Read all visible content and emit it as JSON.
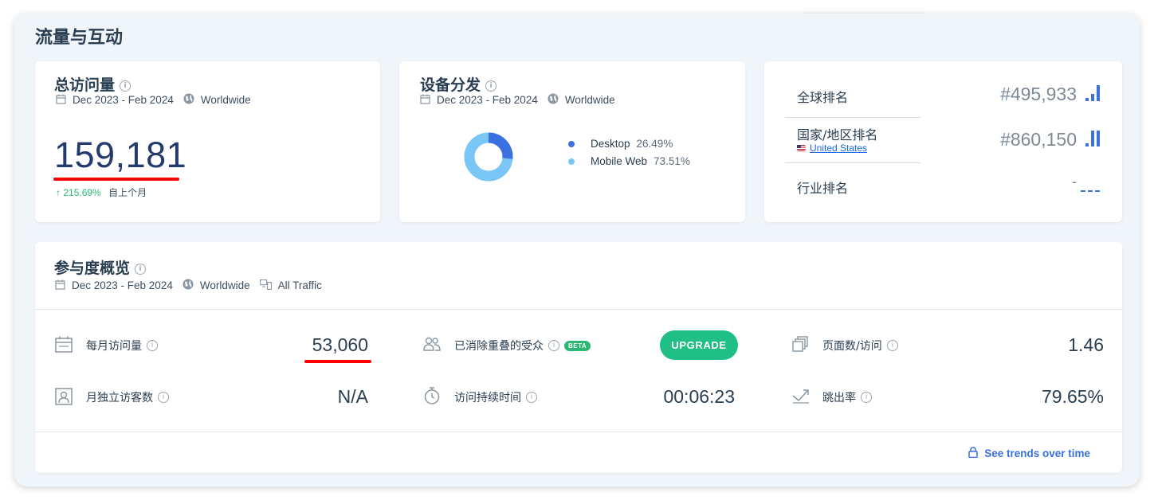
{
  "section_title": "流量与互动",
  "colors": {
    "accent_blue": "#3a70e0",
    "light_blue": "#7ac6f7",
    "green": "#2bb673",
    "red_underline": "#ff0000"
  },
  "total_visits": {
    "title": "总访问量",
    "date_range": "Dec 2023 - Feb 2024",
    "region": "Worldwide",
    "value": "159,181",
    "change_arrow": "↑",
    "change_pct": "215.69%",
    "change_label": "自上个月"
  },
  "device": {
    "title": "设备分发",
    "date_range": "Dec 2023 - Feb 2024",
    "region": "Worldwide",
    "chart_data": {
      "type": "pie",
      "labels": [
        "Desktop",
        "Mobile Web"
      ],
      "values": [
        26.49,
        73.51
      ],
      "colors": [
        "#3a70e0",
        "#7ac6f7"
      ]
    },
    "legend": [
      {
        "name": "Desktop",
        "pct": "26.49%"
      },
      {
        "name": "Mobile Web",
        "pct": "73.51%"
      }
    ]
  },
  "rankings": {
    "global_label": "全球排名",
    "global_value": "#495,933",
    "country_label": "国家/地区排名",
    "country_name": "United States",
    "country_value": "#860,150",
    "industry_label": "行业排名",
    "industry_value": "-"
  },
  "engagement": {
    "title": "参与度概览",
    "date_range": "Dec 2023 - Feb 2024",
    "region": "Worldwide",
    "traffic": "All Traffic",
    "monthly_visits_label": "每月访问量",
    "monthly_visits_value": "53,060",
    "dedup_label": "已消除重叠的受众",
    "beta": "BETA",
    "upgrade_label": "UPGRADE",
    "pages_label": "页面数/访问",
    "pages_value": "1.46",
    "unique_label": "月独立访客数",
    "unique_value": "N/A",
    "duration_label": "访问持续时间",
    "duration_value": "00:06:23",
    "bounce_label": "跳出率",
    "bounce_value": "79.65%",
    "trends_link": "See trends over time"
  }
}
